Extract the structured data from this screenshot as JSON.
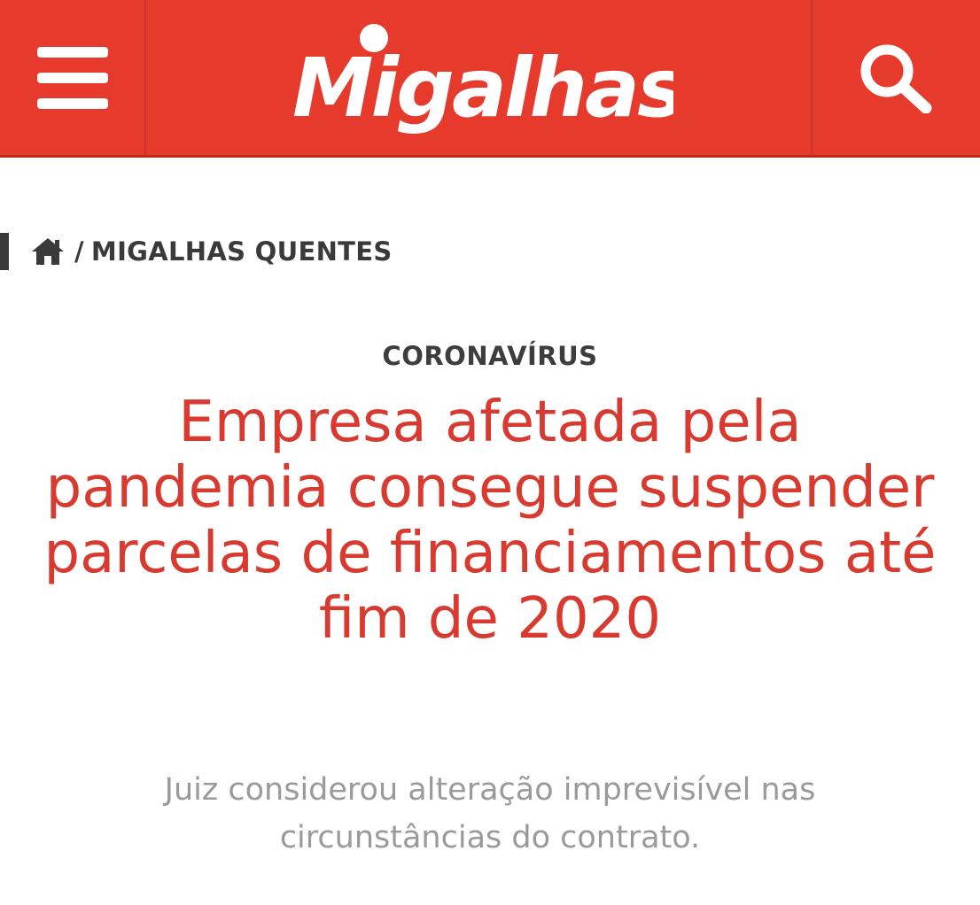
{
  "header": {
    "brand": "Migalhas",
    "background_color": "#e63a2c",
    "menu_icon": "hamburger-menu-icon",
    "search_icon": "search-icon"
  },
  "breadcrumb": {
    "home_icon": "home-icon",
    "separator": "/",
    "section": "MIGALHAS QUENTES"
  },
  "article": {
    "category": "CORONAVÍRUS",
    "headline": "Empresa afetada pela pandemia consegue suspender parcelas de financiamentos até fim de 2020",
    "subtitle": "Juiz considerou alteração imprevisível nas circunstâncias do contrato.",
    "headline_color": "#d83a30"
  }
}
